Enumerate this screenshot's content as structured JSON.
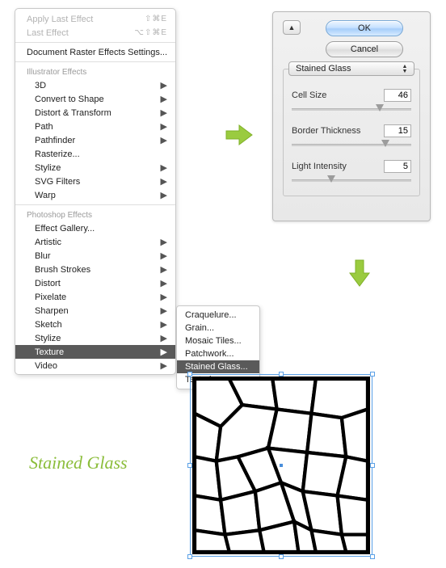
{
  "menu": {
    "apply_last": "Apply Last Effect",
    "apply_last_kbd": "⇧⌘E",
    "last_effect": "Last Effect",
    "last_effect_kbd": "⌥⇧⌘E",
    "raster_settings": "Document Raster Effects Settings...",
    "section_illustrator": "Illustrator Effects",
    "section_photoshop": "Photoshop Effects",
    "illustrator_items": [
      "3D",
      "Convert to Shape",
      "Distort & Transform",
      "Path",
      "Pathfinder",
      "Rasterize...",
      "Stylize",
      "SVG Filters",
      "Warp"
    ],
    "photoshop_items": [
      "Effect Gallery...",
      "Artistic",
      "Blur",
      "Brush Strokes",
      "Distort",
      "Pixelate",
      "Sharpen",
      "Sketch",
      "Stylize",
      "Texture",
      "Video"
    ]
  },
  "submenu": {
    "items": [
      "Craquelure...",
      "Grain...",
      "Mosaic Tiles...",
      "Patchwork...",
      "Stained Glass...",
      "Texturizer..."
    ]
  },
  "dialog": {
    "ok": "OK",
    "cancel": "Cancel",
    "filter_name": "Stained Glass",
    "params": [
      {
        "label": "Cell Size",
        "value": "46",
        "pos": 70
      },
      {
        "label": "Border Thickness",
        "value": "15",
        "pos": 75
      },
      {
        "label": "Light Intensity",
        "value": "5",
        "pos": 30
      }
    ]
  },
  "caption": "Stained Glass"
}
